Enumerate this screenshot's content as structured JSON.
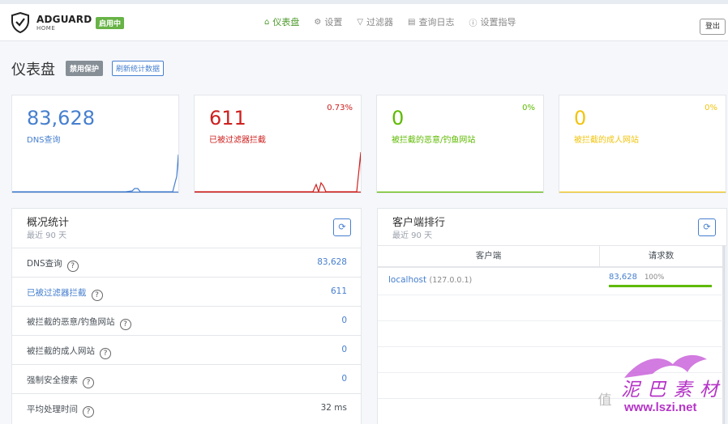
{
  "header": {
    "logo_text": "ADGUARD",
    "logo_sub": "HOME",
    "status_badge": "启用中",
    "nav": [
      {
        "label": "仪表盘",
        "icon": "home-icon",
        "active": true
      },
      {
        "label": "设置",
        "icon": "gear-icon",
        "active": false
      },
      {
        "label": "过滤器",
        "icon": "filter-icon",
        "active": false
      },
      {
        "label": "查询日志",
        "icon": "document-icon",
        "active": false
      },
      {
        "label": "设置指导",
        "icon": "help-circle-icon",
        "active": false
      }
    ],
    "logout": "登出"
  },
  "page": {
    "title": "仪表盘",
    "disable_button": "禁用保护",
    "refresh_button": "刷新统计数据"
  },
  "stats": [
    {
      "value": "83,628",
      "label": "DNS查询",
      "percent": "",
      "color": "#467fcf"
    },
    {
      "value": "611",
      "label": "已被过滤器拦截",
      "percent": "0.73%",
      "color": "#cd201f"
    },
    {
      "value": "0",
      "label": "被拦截的恶意/钓鱼网站",
      "percent": "0%",
      "color": "#5eba00"
    },
    {
      "value": "0",
      "label": "被拦截的成人网站",
      "percent": "0%",
      "color": "#f1c40f"
    }
  ],
  "summary": {
    "title": "概况统计",
    "subtitle": "最近 90 天",
    "rows": [
      {
        "label": "DNS查询",
        "value": "83,628",
        "link": false
      },
      {
        "label": "已被过滤器拦截",
        "value": "611",
        "link": true
      },
      {
        "label": "被拦截的恶意/钓鱼网站",
        "value": "0",
        "link": false
      },
      {
        "label": "被拦截的成人网站",
        "value": "0",
        "link": false
      },
      {
        "label": "强制安全搜索",
        "value": "0",
        "link": false
      },
      {
        "label": "平均处理时间",
        "value": "32 ms",
        "link": false
      }
    ]
  },
  "clients": {
    "title": "客户端排行",
    "subtitle": "最近 90 天",
    "col_client": "客户端",
    "col_requests": "请求数",
    "rows": [
      {
        "name": "localhost",
        "ip": "(127.0.0.1)",
        "requests": "83,628",
        "percent": "100%",
        "fill": 1.0
      }
    ]
  },
  "watermark": {
    "zhi": "值",
    "script": "泥 巴 素 材",
    "url": "www.lszi.net"
  }
}
